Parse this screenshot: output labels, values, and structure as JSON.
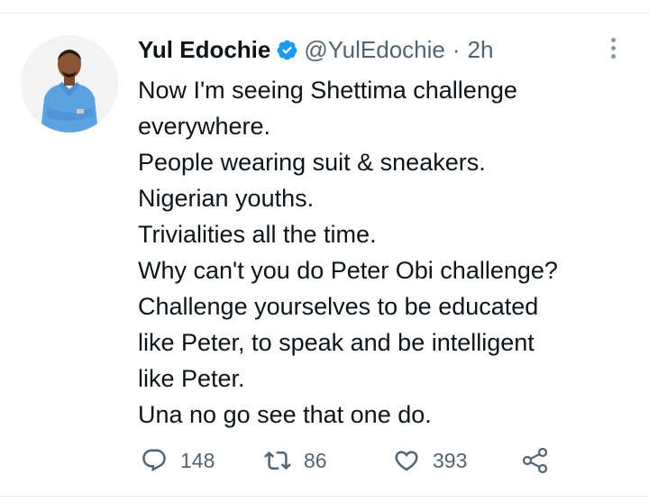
{
  "tweet": {
    "display_name": "Yul Edochie",
    "handle": "@YulEdochie",
    "separator": "·",
    "timestamp": "2h",
    "lines": [
      "Now I'm seeing Shettima challenge",
      "everywhere.",
      "People wearing suit & sneakers.",
      "Nigerian youths.",
      "Trivialities all the time.",
      "Why can't you do Peter Obi challenge?",
      "Challenge yourselves to be educated",
      "like Peter, to speak and be intelligent",
      "like Peter.",
      "Una no go see that one do."
    ],
    "reply_count": "148",
    "retweet_count": "86",
    "like_count": "393"
  },
  "icons": {
    "verified": "verified-badge-icon",
    "more": "more-vertical-icon",
    "reply": "reply-icon",
    "retweet": "retweet-icon",
    "like": "heart-icon",
    "share": "share-icon"
  },
  "colors": {
    "primary_text": "#0f1419",
    "secondary_text": "#536471",
    "verified": "#1d9bf0",
    "divider": "#e6ecf0"
  }
}
